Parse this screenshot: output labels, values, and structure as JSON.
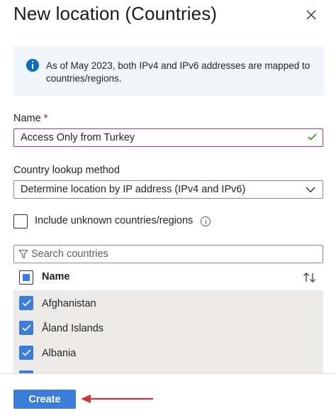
{
  "panel": {
    "title": "New location (Countries)"
  },
  "info": {
    "message": "As of May 2023, both IPv4 and IPv6 addresses are mapped to countries/regions."
  },
  "name_field": {
    "label": "Name",
    "required_marker": "*",
    "value": "Access Only from Turkey"
  },
  "lookup": {
    "label": "Country lookup method",
    "selected": "Determine location by IP address (IPv4 and IPv6)"
  },
  "unknown": {
    "label": "Include unknown countries/regions",
    "checked": false
  },
  "search": {
    "placeholder": "Search countries"
  },
  "table": {
    "column_name": "Name",
    "rows": [
      {
        "label": "Afghanistan",
        "checked": true
      },
      {
        "label": "Åland Islands",
        "checked": true
      },
      {
        "label": "Albania",
        "checked": true
      },
      {
        "label": "",
        "checked": true
      }
    ]
  },
  "footer": {
    "create_label": "Create"
  },
  "colors": {
    "accent": "#3b7dd8",
    "info_bg": "#eff6fc",
    "focus_border": "#8a3ea8",
    "valid_check": "#107c10",
    "annotation_arrow": "#d13438"
  },
  "icons": {
    "close": "close-icon",
    "info": "info-icon",
    "valid": "checkmark-icon",
    "dropdown": "chevron-down-icon",
    "tooltip": "info-circle-icon",
    "filter": "filter-icon",
    "sort": "sort-icon",
    "annotation": "arrow-left-icon"
  }
}
